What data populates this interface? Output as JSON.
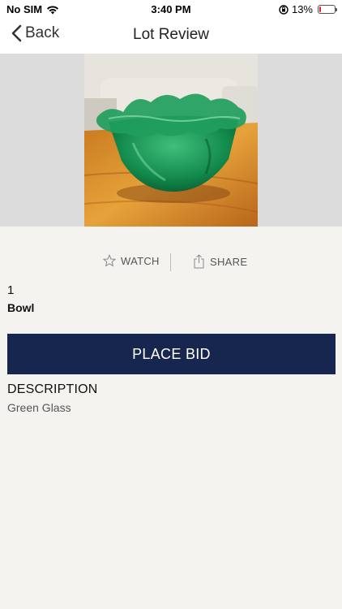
{
  "status_bar": {
    "carrier": "No SIM",
    "time": "3:40 PM",
    "battery_percent": "13%",
    "battery_level": 0.13,
    "icons": [
      "wifi-icon",
      "orientation-lock-icon",
      "battery-icon"
    ],
    "battery_color": "#e0262b"
  },
  "nav": {
    "back_label": "Back",
    "title": "Lot Review"
  },
  "lot": {
    "image_icon": "green-glass-bowl-photo",
    "number": "1",
    "title": "Bowl",
    "actions": {
      "watch_label": "WATCH",
      "share_label": "SHARE",
      "watch_icon": "star-icon",
      "share_icon": "share-icon"
    },
    "place_bid_label": "PLACE BID",
    "description_heading": "DESCRIPTION",
    "description": "Green Glass"
  },
  "colors": {
    "accent": "#17264f",
    "background": "#f5f3ef"
  }
}
